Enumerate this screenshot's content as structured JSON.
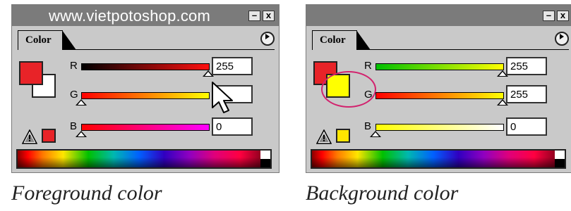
{
  "watermark": "www.vietpotoshop.com",
  "panels": [
    {
      "tab_label": "Color",
      "minimize_label": "–",
      "close_label": "x",
      "menu_icon": "play-triangle-icon",
      "foreground_color": "#e82328",
      "background_color": "#ffffff",
      "warning_icon": "gamut-warning-icon",
      "gamut_color": "#e82328",
      "channels": [
        {
          "label": "R",
          "value": "255",
          "gradient": [
            "#000000",
            "#ff1010"
          ],
          "thumb_position": 1.0
        },
        {
          "label": "G",
          "value": "",
          "gradient": [
            "#ff0000",
            "#ffff00"
          ],
          "thumb_position": 0.0
        },
        {
          "label": "B",
          "value": "0",
          "gradient": [
            "#ff0000",
            "#ff00ff"
          ],
          "thumb_position": 0.0
        }
      ],
      "caption": "Foreground color"
    },
    {
      "tab_label": "Color",
      "minimize_label": "–",
      "close_label": "x",
      "menu_icon": "play-triangle-icon",
      "foreground_color": "#e82328",
      "background_color": "#ffff00",
      "warning_icon": "gamut-warning-icon",
      "gamut_color": "#ffe600",
      "channels": [
        {
          "label": "R",
          "value": "255",
          "gradient": [
            "#00c000",
            "#ffff00"
          ],
          "thumb_position": 1.0
        },
        {
          "label": "G",
          "value": "255",
          "gradient": [
            "#ff0000",
            "#ffff00"
          ],
          "thumb_position": 1.0
        },
        {
          "label": "B",
          "value": "0",
          "gradient": [
            "#ffff00",
            "#ffffff"
          ],
          "thumb_position": 0.0
        }
      ],
      "caption": "Background color"
    }
  ]
}
